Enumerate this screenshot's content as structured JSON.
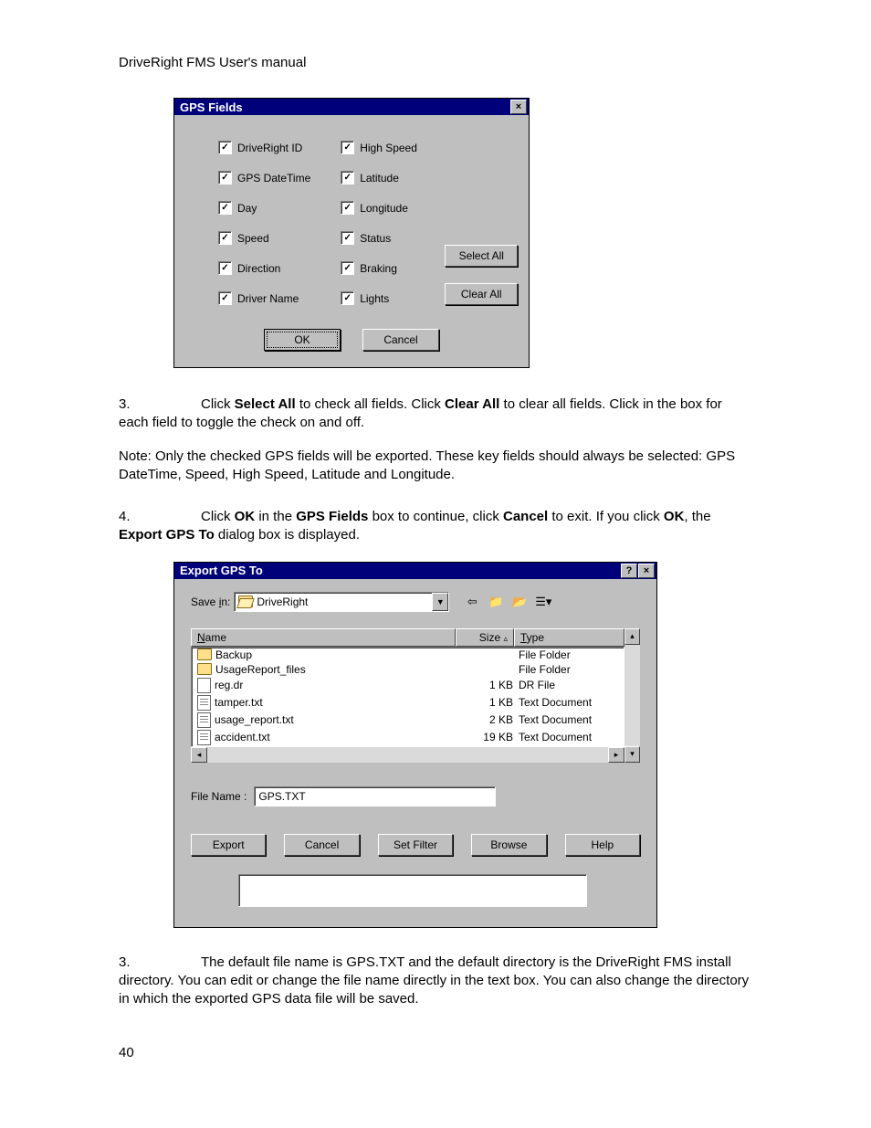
{
  "header": "DriveRight FMS User's manual",
  "pageNumber": "40",
  "dialog1": {
    "title": "GPS Fields",
    "close": "×",
    "fieldsLeft": [
      "DriveRight ID",
      "GPS DateTime",
      "Day",
      "Speed",
      "Direction",
      "Driver Name"
    ],
    "fieldsRight": [
      "High Speed",
      "Latitude",
      "Longitude",
      "Status",
      "Braking",
      "Lights"
    ],
    "selectAll": "Select All",
    "clearAll": "Clear All",
    "ok": "OK",
    "cancel": "Cancel"
  },
  "para1a": "3.",
  "para1b": "Click ",
  "para1c": "Select All",
  "para1d": " to check all fields. Click ",
  "para1e": "Clear All",
  "para1f": " to clear all fields. Click in the box for each field to toggle the check on and off.",
  "para2": "Note: Only the checked GPS fields will be exported. These key fields should always be selected: GPS DateTime, Speed, High Speed, Latitude and Longitude.",
  "para3a": "4.",
  "para3b": "Click ",
  "para3c": "OK",
  "para3d": " in the ",
  "para3e": "GPS Fields",
  "para3f": " box to continue, click ",
  "para3g": "Cancel",
  "para3h": " to exit. If you click ",
  "para3i": "OK",
  "para3j": ", the ",
  "para3k": "Export GPS To",
  "para3l": " dialog box is displayed.",
  "dialog2": {
    "title": "Export GPS To",
    "help": "?",
    "close": "×",
    "saveInLabel": "Save in:",
    "saveInValue": "DriveRight",
    "cols": {
      "name": "Name",
      "size": "Size",
      "type": "Type"
    },
    "rows": [
      {
        "icon": "folder",
        "name": "Backup",
        "size": "",
        "type": "File Folder"
      },
      {
        "icon": "folder",
        "name": "UsageReport_files",
        "size": "",
        "type": "File Folder"
      },
      {
        "icon": "file",
        "name": "reg.dr",
        "size": "1 KB",
        "type": "DR File"
      },
      {
        "icon": "txt",
        "name": "tamper.txt",
        "size": "1 KB",
        "type": "Text Document"
      },
      {
        "icon": "txt",
        "name": "usage_report.txt",
        "size": "2 KB",
        "type": "Text Document"
      },
      {
        "icon": "txt",
        "name": "accident.txt",
        "size": "19 KB",
        "type": "Text Document"
      }
    ],
    "fileNameLabel": "File Name :",
    "fileNameValue": "GPS.TXT",
    "buttons": [
      "Export",
      "Cancel",
      "Set Filter",
      "Browse",
      "Help"
    ]
  },
  "para4a": "3.",
  "para4b": "The default file name is GPS.TXT and the default directory is the DriveRight FMS install directory. You can edit or change the file name directly in the text box. You can also change the directory in which the exported GPS data file will be saved."
}
